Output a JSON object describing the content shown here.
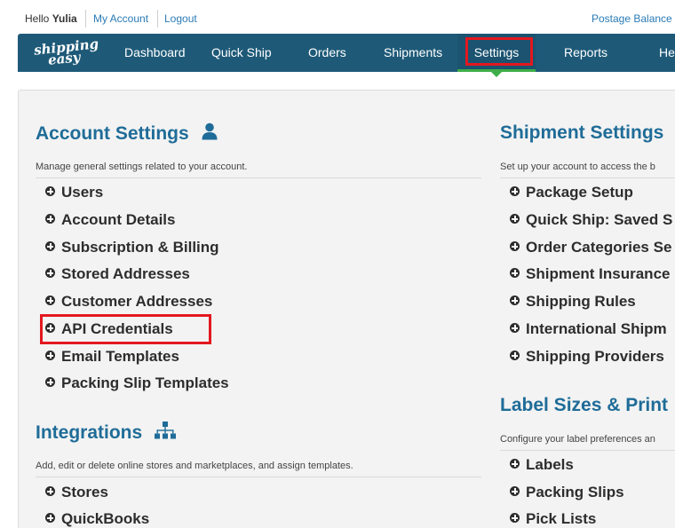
{
  "top": {
    "hello_prefix": "Hello",
    "user_name": "Yulia",
    "my_account": "My Account",
    "logout": "Logout",
    "postage_balance": "Postage Balance"
  },
  "logo": {
    "line1": "shipping",
    "line2": "easy"
  },
  "nav": {
    "dashboard": "Dashboard",
    "quick_ship": "Quick Ship",
    "orders": "Orders",
    "shipments": "Shipments",
    "settings": "Settings",
    "reports": "Reports",
    "help": "He",
    "active": "Settings"
  },
  "account": {
    "title": "Account Settings",
    "icon": "user-icon",
    "desc": "Manage general settings related to your account.",
    "items": [
      "Users",
      "Account Details",
      "Subscription & Billing",
      "Stored Addresses",
      "Customer Addresses",
      "API Credentials",
      "Email Templates",
      "Packing Slip Templates"
    ]
  },
  "integrations": {
    "title": "Integrations",
    "icon": "sitemap-icon",
    "desc": "Add, edit or delete online stores and marketplaces, and assign templates.",
    "items": [
      "Stores",
      "QuickBooks"
    ]
  },
  "shipment": {
    "title": "Shipment Settings",
    "desc": "Set up your account to access the b",
    "items": [
      "Package Setup",
      "Quick Ship: Saved S",
      "Order Categories Se",
      "Shipment Insurance",
      "Shipping Rules",
      "International Shipm",
      "Shipping Providers"
    ]
  },
  "label": {
    "title": "Label Sizes & Print",
    "desc": "Configure your label preferences an",
    "items": [
      "Labels",
      "Packing Slips",
      "Pick Lists"
    ]
  },
  "colors": {
    "nav_bg": "#1e5a78",
    "accent": "#3fae49",
    "title": "#1f6c98",
    "highlight": "#e3181f"
  }
}
